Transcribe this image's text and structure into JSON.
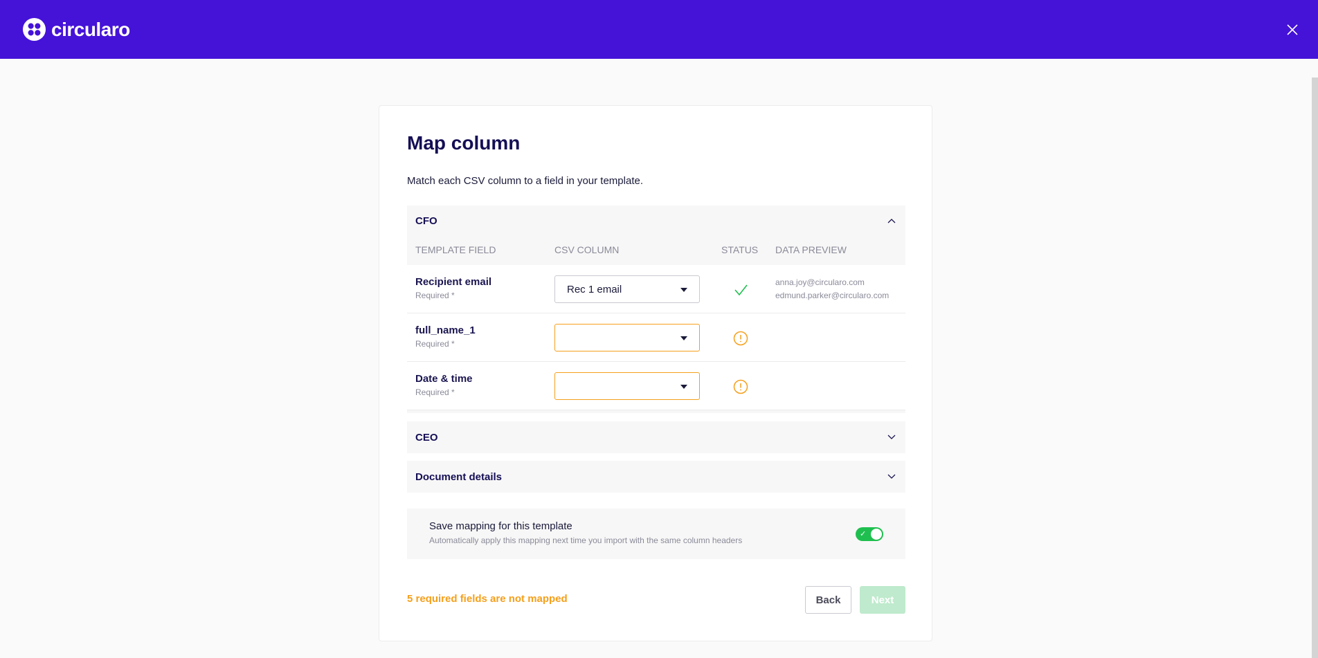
{
  "app": {
    "brand": "circularo"
  },
  "colors": {
    "header": "#4512d8",
    "accent_green": "#1fbf4f",
    "warning": "#f59f1a",
    "title": "#150f55"
  },
  "header": {
    "close_icon": "close-icon"
  },
  "page": {
    "title": "Map column",
    "subtitle": "Match each CSV column to a field in your template."
  },
  "sections": {
    "cfo": {
      "title": "CFO",
      "expanded": true,
      "columns": {
        "template_field": "TEMPLATE FIELD",
        "csv_column": "CSV COLUMN",
        "status": "STATUS",
        "data_preview": "DATA PREVIEW"
      },
      "rows": [
        {
          "field": "Recipient email",
          "required": "Required *",
          "csv_value": "Rec 1 email",
          "status": "ok",
          "preview": [
            "anna.joy@circularo.com",
            "edmund.parker@circularo.com"
          ]
        },
        {
          "field": "full_name_1",
          "required": "Required *",
          "csv_value": "",
          "status": "warning",
          "preview": []
        },
        {
          "field": "Date & time",
          "required": "Required *",
          "csv_value": "",
          "status": "warning",
          "preview": []
        }
      ]
    },
    "ceo": {
      "title": "CEO",
      "expanded": false
    },
    "document_details": {
      "title": "Document details",
      "expanded": false
    }
  },
  "save_mapping": {
    "title": "Save mapping for this template",
    "description": "Automatically apply this mapping next time you import with the same column headers",
    "enabled": true
  },
  "footer": {
    "warning": "5 required fields are not mapped",
    "back_label": "Back",
    "next_label": "Next"
  }
}
